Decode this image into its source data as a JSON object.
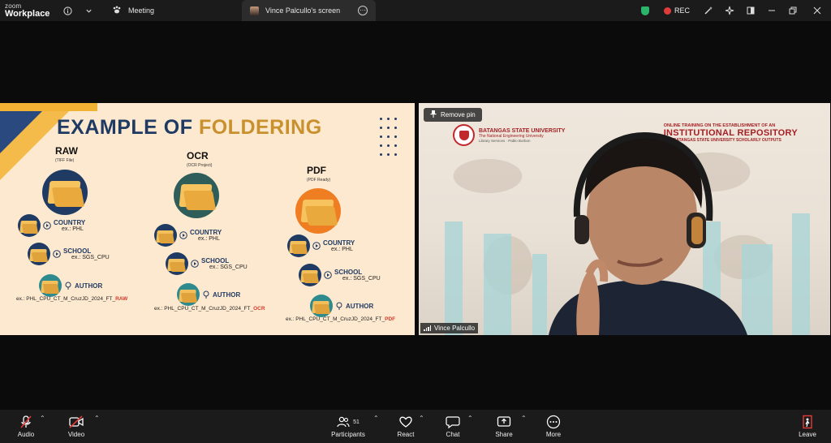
{
  "app": {
    "logo_line1": "zoom",
    "logo_line2": "Workplace"
  },
  "tabs": [
    {
      "label": "Meeting"
    },
    {
      "label": "Vince Palcullo's screen"
    }
  ],
  "topbar_right": {
    "rec_label": "REC"
  },
  "slide": {
    "title_part1": "EXAMPLE OF",
    "title_part2": "FOLDERING",
    "columns": [
      {
        "title": "RAW",
        "subtitle": "(TIFF File)",
        "filename_prefix": "ex.: PHL_CPU_CT_M_CruzJD_2024_FT_",
        "filename_suffix": "RAW"
      },
      {
        "title": "OCR",
        "subtitle": "(OCR Project)",
        "filename_prefix": "ex.: PHL_CPU_CT_M_CruzJD_2024_FT_",
        "filename_suffix": "OCR"
      },
      {
        "title": "PDF",
        "subtitle": "(PDF Ready)",
        "filename_prefix": "ex.: PHL_CPU_CT_M_CruzJD_2024_FT_",
        "filename_suffix": "PDF"
      }
    ],
    "levels": [
      {
        "label": "COUNTRY",
        "example": "ex.: PHL"
      },
      {
        "label": "SCHOOL",
        "example": "ex.: SGS_CPU"
      },
      {
        "label": "AUTHOR",
        "example": ""
      }
    ]
  },
  "camera": {
    "remove_pin": "Remove pin",
    "university_name": "BATANGAS STATE UNIVERSITY",
    "university_tagline": "The National Engineering University",
    "university_unit": "Library Services · Pablo Borbon",
    "training_line1": "ONLINE TRAINING ON THE ESTABLISHMENT OF AN",
    "training_line2": "INSTITUTIONAL REPOSITORY",
    "training_line3": "FOR BATANGAS STATE UNIVERSITY SCHOLARLY OUTPUTS",
    "participant_name": "Vince Palcullo"
  },
  "toolbar": {
    "audio": "Audio",
    "video": "Video",
    "participants": "Participants",
    "participants_count": "51",
    "react": "React",
    "chat": "Chat",
    "share": "Share",
    "more": "More",
    "leave": "Leave"
  },
  "colors": {
    "accent_navy": "#1f3a63",
    "accent_gold": "#c9902e",
    "highlight_red": "#d23a2a",
    "rec_red": "#e03b3b"
  }
}
